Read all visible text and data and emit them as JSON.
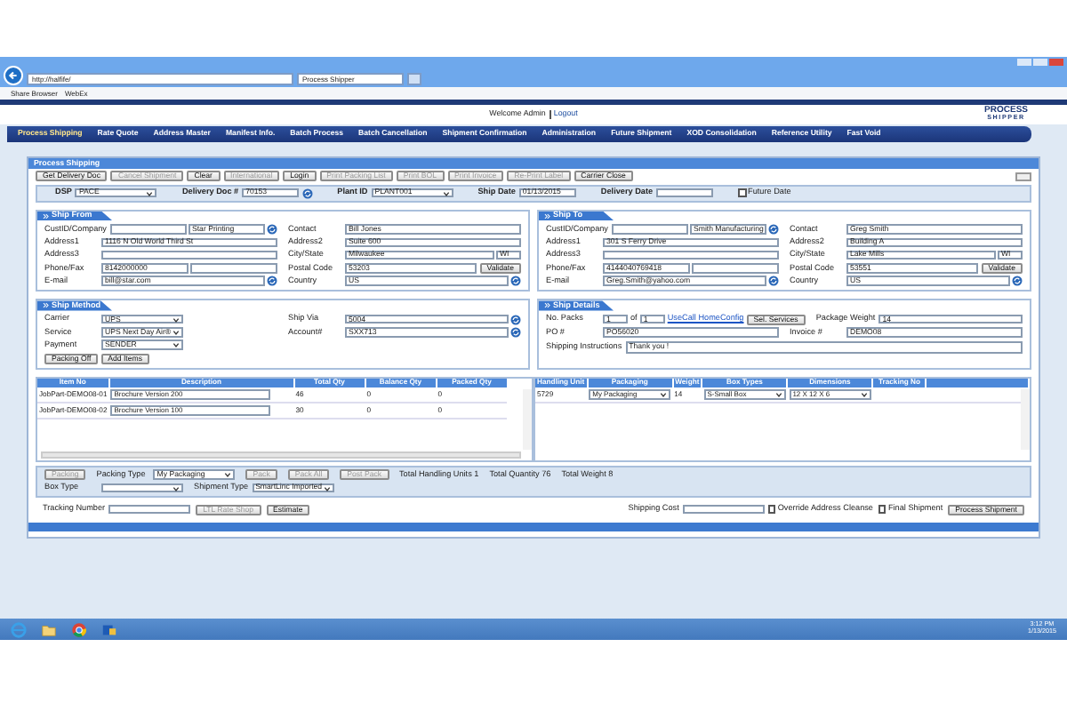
{
  "browser": {
    "address": "http://halfife/",
    "tab": "Process Shipper",
    "favorites": [
      "Share Browser",
      "WebEx"
    ]
  },
  "header": {
    "welcome": "Welcome Admin",
    "logout": "Logout",
    "logo_top": "PROCESS",
    "logo_bottom": "SHIPPER"
  },
  "nav": [
    {
      "label": "Process Shipping",
      "selected": true
    },
    {
      "label": "Rate Quote",
      "selected": false
    },
    {
      "label": "Address Master",
      "selected": false
    },
    {
      "label": "Manifest Info.",
      "selected": false
    },
    {
      "label": "Batch Process",
      "selected": false
    },
    {
      "label": "Batch Cancellation",
      "selected": false
    },
    {
      "label": "Shipment Confirmation",
      "selected": false
    },
    {
      "label": "Administration",
      "selected": false
    },
    {
      "label": "Future Shipment",
      "selected": false
    },
    {
      "label": "XOD Consolidation",
      "selected": false
    },
    {
      "label": "Reference Utility",
      "selected": false
    },
    {
      "label": "Fast Void",
      "selected": false
    }
  ],
  "panel_title": "Process Shipping",
  "toolbar": [
    {
      "label": "Get Delivery Doc",
      "disabled": false
    },
    {
      "label": "Cancel Shipment",
      "disabled": true
    },
    {
      "label": "Clear",
      "disabled": false
    },
    {
      "label": "International",
      "disabled": true
    },
    {
      "label": "Login",
      "disabled": false
    },
    {
      "label": "Print Packing List",
      "disabled": true
    },
    {
      "label": "Print BOL",
      "disabled": true
    },
    {
      "label": "Print Invoice",
      "disabled": true
    },
    {
      "label": "Re-Print Label",
      "disabled": true
    },
    {
      "label": "Carrier Close",
      "disabled": false
    }
  ],
  "top_row": [
    {
      "label": "DSP",
      "items": [
        {
          "kind": "select",
          "value": "PACE"
        }
      ]
    },
    {
      "label": "Delivery Doc #",
      "items": [
        {
          "kind": "text",
          "value": "70153"
        },
        {
          "kind": "lookup"
        }
      ]
    },
    {
      "label": "Plant ID",
      "items": [
        {
          "kind": "select",
          "value": "PLANT001"
        }
      ]
    },
    {
      "label": "Ship Date",
      "items": [
        {
          "kind": "text",
          "value": "01/13/2015"
        }
      ]
    },
    {
      "label": "Delivery Date",
      "items": [
        {
          "kind": "text"
        }
      ]
    },
    {
      "items": [
        {
          "kind": "checkbox",
          "label": "Future Date",
          "checked": false
        }
      ]
    }
  ],
  "ship_from": {
    "title": "Ship From",
    "rows": [
      [
        {
          "label": "CustID/Company",
          "items": [
            {
              "kind": "text"
            },
            {
              "kind": "text",
              "value": "Star Printing"
            },
            {
              "kind": "lookup"
            }
          ]
        },
        {
          "label": "Contact",
          "items": [
            {
              "kind": "text",
              "value": "Bill Jones"
            }
          ]
        }
      ],
      [
        {
          "label": "Address1",
          "items": [
            {
              "kind": "text",
              "value": "1116 N Old World Third St"
            }
          ]
        },
        {
          "label": "Address2",
          "items": [
            {
              "kind": "text",
              "value": "Suite 600"
            }
          ]
        }
      ],
      [
        {
          "label": "Address3",
          "items": [
            {
              "kind": "text"
            }
          ]
        },
        {
          "label": "City/State",
          "items": [
            {
              "kind": "text",
              "value": "Milwaukee"
            },
            {
              "kind": "short",
              "value": "WI"
            }
          ]
        }
      ],
      [
        {
          "label": "Phone/Fax",
          "items": [
            {
              "kind": "text",
              "value": "8142000000"
            },
            {
              "kind": "text"
            }
          ]
        },
        {
          "label": "Postal Code",
          "items": [
            {
              "kind": "text",
              "value": "53203"
            },
            {
              "kind": "button",
              "label": "Validate",
              "disabled": false
            }
          ]
        }
      ],
      [
        {
          "label": "E-mail",
          "items": [
            {
              "kind": "text",
              "value": "bill@star.com"
            },
            {
              "kind": "lookup"
            }
          ]
        },
        {
          "label": "Country",
          "items": [
            {
              "kind": "text",
              "value": "US"
            },
            {
              "kind": "lookup"
            }
          ]
        }
      ]
    ]
  },
  "ship_to": {
    "title": "Ship To",
    "rows": [
      [
        {
          "label": "CustID/Company",
          "items": [
            {
              "kind": "text"
            },
            {
              "kind": "text",
              "value": "Smith Manufacturing"
            },
            {
              "kind": "lookup"
            }
          ]
        },
        {
          "label": "Contact",
          "items": [
            {
              "kind": "text",
              "value": "Greg Smith"
            }
          ]
        }
      ],
      [
        {
          "label": "Address1",
          "items": [
            {
              "kind": "text",
              "value": "301 S Ferry Drive"
            }
          ]
        },
        {
          "label": "Address2",
          "items": [
            {
              "kind": "text",
              "value": "Building A"
            }
          ]
        }
      ],
      [
        {
          "label": "Address3",
          "items": [
            {
              "kind": "text"
            }
          ]
        },
        {
          "label": "City/State",
          "items": [
            {
              "kind": "text",
              "value": "Lake Mills"
            },
            {
              "kind": "short",
              "value": "WI"
            }
          ]
        }
      ],
      [
        {
          "label": "Phone/Fax",
          "items": [
            {
              "kind": "text",
              "value": "4144040769418"
            },
            {
              "kind": "text"
            }
          ]
        },
        {
          "label": "Postal Code",
          "items": [
            {
              "kind": "text",
              "value": "53551"
            },
            {
              "kind": "button",
              "label": "Validate",
              "disabled": false
            }
          ]
        }
      ],
      [
        {
          "label": "E-mail",
          "items": [
            {
              "kind": "text",
              "value": "Greg.Smith@yahoo.com"
            },
            {
              "kind": "lookup"
            }
          ]
        },
        {
          "label": "Country",
          "items": [
            {
              "kind": "text",
              "value": "US"
            },
            {
              "kind": "lookup"
            }
          ]
        }
      ]
    ]
  },
  "ship_method": {
    "title": "Ship Method",
    "rows": [
      [
        {
          "label": "Carrier",
          "items": [
            {
              "kind": "select",
              "value": "UPS"
            }
          ]
        },
        {
          "label": "Ship Via",
          "items": [
            {
              "kind": "text",
              "value": "5004"
            },
            {
              "kind": "lookup"
            }
          ]
        }
      ],
      [
        {
          "label": "Service",
          "items": [
            {
              "kind": "select",
              "value": "UPS Next Day Air®"
            }
          ]
        },
        {
          "label": "Account#",
          "items": [
            {
              "kind": "text",
              "value": "SXX713"
            },
            {
              "kind": "lookup"
            }
          ]
        }
      ],
      [
        {
          "label": "Payment",
          "items": [
            {
              "kind": "select",
              "value": "SENDER"
            }
          ]
        }
      ],
      [
        {
          "items": [
            {
              "kind": "button",
              "label": "Packing Off",
              "disabled": false
            },
            {
              "kind": "button",
              "label": "Add Items",
              "disabled": false
            }
          ]
        }
      ]
    ]
  },
  "ship_details": {
    "title": "Ship Details",
    "rows": [
      [
        {
          "label": "No. Packs",
          "items": [
            {
              "kind": "short",
              "value": "1"
            },
            {
              "kind": "word",
              "text": "of"
            },
            {
              "kind": "short",
              "value": "1"
            },
            {
              "kind": "link",
              "text": "UseCall HomeConfig"
            },
            {
              "kind": "button",
              "label": "Sel. Services",
              "disabled": false
            }
          ]
        },
        {
          "label": "Package Weight",
          "items": [
            {
              "kind": "text",
              "value": "14"
            }
          ]
        }
      ],
      [
        {
          "label": "PO #",
          "items": [
            {
              "kind": "text",
              "value": "PO56020"
            }
          ]
        },
        {
          "label": "Invoice #",
          "items": [
            {
              "kind": "text",
              "value": "DEMO08"
            }
          ]
        }
      ],
      [
        {
          "label": "Shipping Instructions",
          "items": [
            {
              "kind": "textarea",
              "value": "Thank you !"
            }
          ]
        }
      ]
    ]
  },
  "items_table": {
    "columns": [
      "Item No",
      "Description",
      "Total Qty",
      "Balance Qty",
      "Packed Qty"
    ],
    "rows": [
      [
        "JobPart-DEMO08-01",
        "Brochure Version 200",
        "46",
        "0",
        "0"
      ],
      [
        "JobPart-DEMO08-02",
        "Brochure Version 100",
        "30",
        "0",
        "0"
      ]
    ]
  },
  "handling_table": {
    "columns": [
      "Handling Unit",
      "Packaging",
      "Weight",
      "Box Types",
      "Dimensions",
      "Tracking No"
    ],
    "rows": [
      [
        {
          "kind": "text",
          "value": "5729"
        },
        {
          "kind": "select",
          "value": "My Packaging"
        },
        {
          "kind": "text",
          "value": "14"
        },
        {
          "kind": "select",
          "value": "S-Small Box"
        },
        {
          "kind": "select",
          "value": "12 X 12 X 6"
        },
        {
          "kind": "blank"
        }
      ]
    ]
  },
  "packing_rows": [
    [
      {
        "items": [
          {
            "kind": "button",
            "label": "Packing",
            "disabled": true
          }
        ]
      },
      {
        "label": "Packing Type",
        "items": [
          {
            "kind": "select",
            "value": "My Packaging"
          }
        ]
      },
      {
        "items": [
          {
            "kind": "button",
            "label": "Pack",
            "disabled": true
          },
          {
            "kind": "button",
            "label": "Pack All",
            "disabled": true
          },
          {
            "kind": "button",
            "label": "Post Pack",
            "disabled": true
          }
        ]
      },
      {
        "items": [
          {
            "kind": "word",
            "text": "Total Handling Units 1"
          },
          {
            "kind": "word",
            "text": "Total Quantity 76"
          },
          {
            "kind": "word",
            "text": "Total Weight 8"
          }
        ]
      }
    ],
    [
      {
        "label": "Box Type",
        "items": [
          {
            "kind": "select"
          }
        ]
      },
      {
        "label": "Shipment Type",
        "items": [
          {
            "kind": "select",
            "value": "SmartLinc Imported"
          }
        ]
      }
    ]
  ],
  "tracking_row": [
    {
      "label": "Tracking Number",
      "items": [
        {
          "kind": "text"
        },
        {
          "kind": "button",
          "label": "LTL Rate Shop",
          "disabled": true
        },
        {
          "kind": "button",
          "label": "Estimate",
          "disabled": false
        }
      ]
    }
  ],
  "cost_row": [
    {
      "label": "Shipping Cost",
      "items": [
        {
          "kind": "text"
        }
      ]
    },
    {
      "items": [
        {
          "kind": "checkbox",
          "label": "Override Address Cleanse",
          "checked": false
        },
        {
          "kind": "checkbox",
          "label": "Final Shipment",
          "checked": false
        },
        {
          "kind": "button",
          "label": "Process Shipment",
          "disabled": false
        }
      ]
    }
  ],
  "taskbar": {
    "time": "3:12 PM",
    "date": "1/13/2015"
  }
}
